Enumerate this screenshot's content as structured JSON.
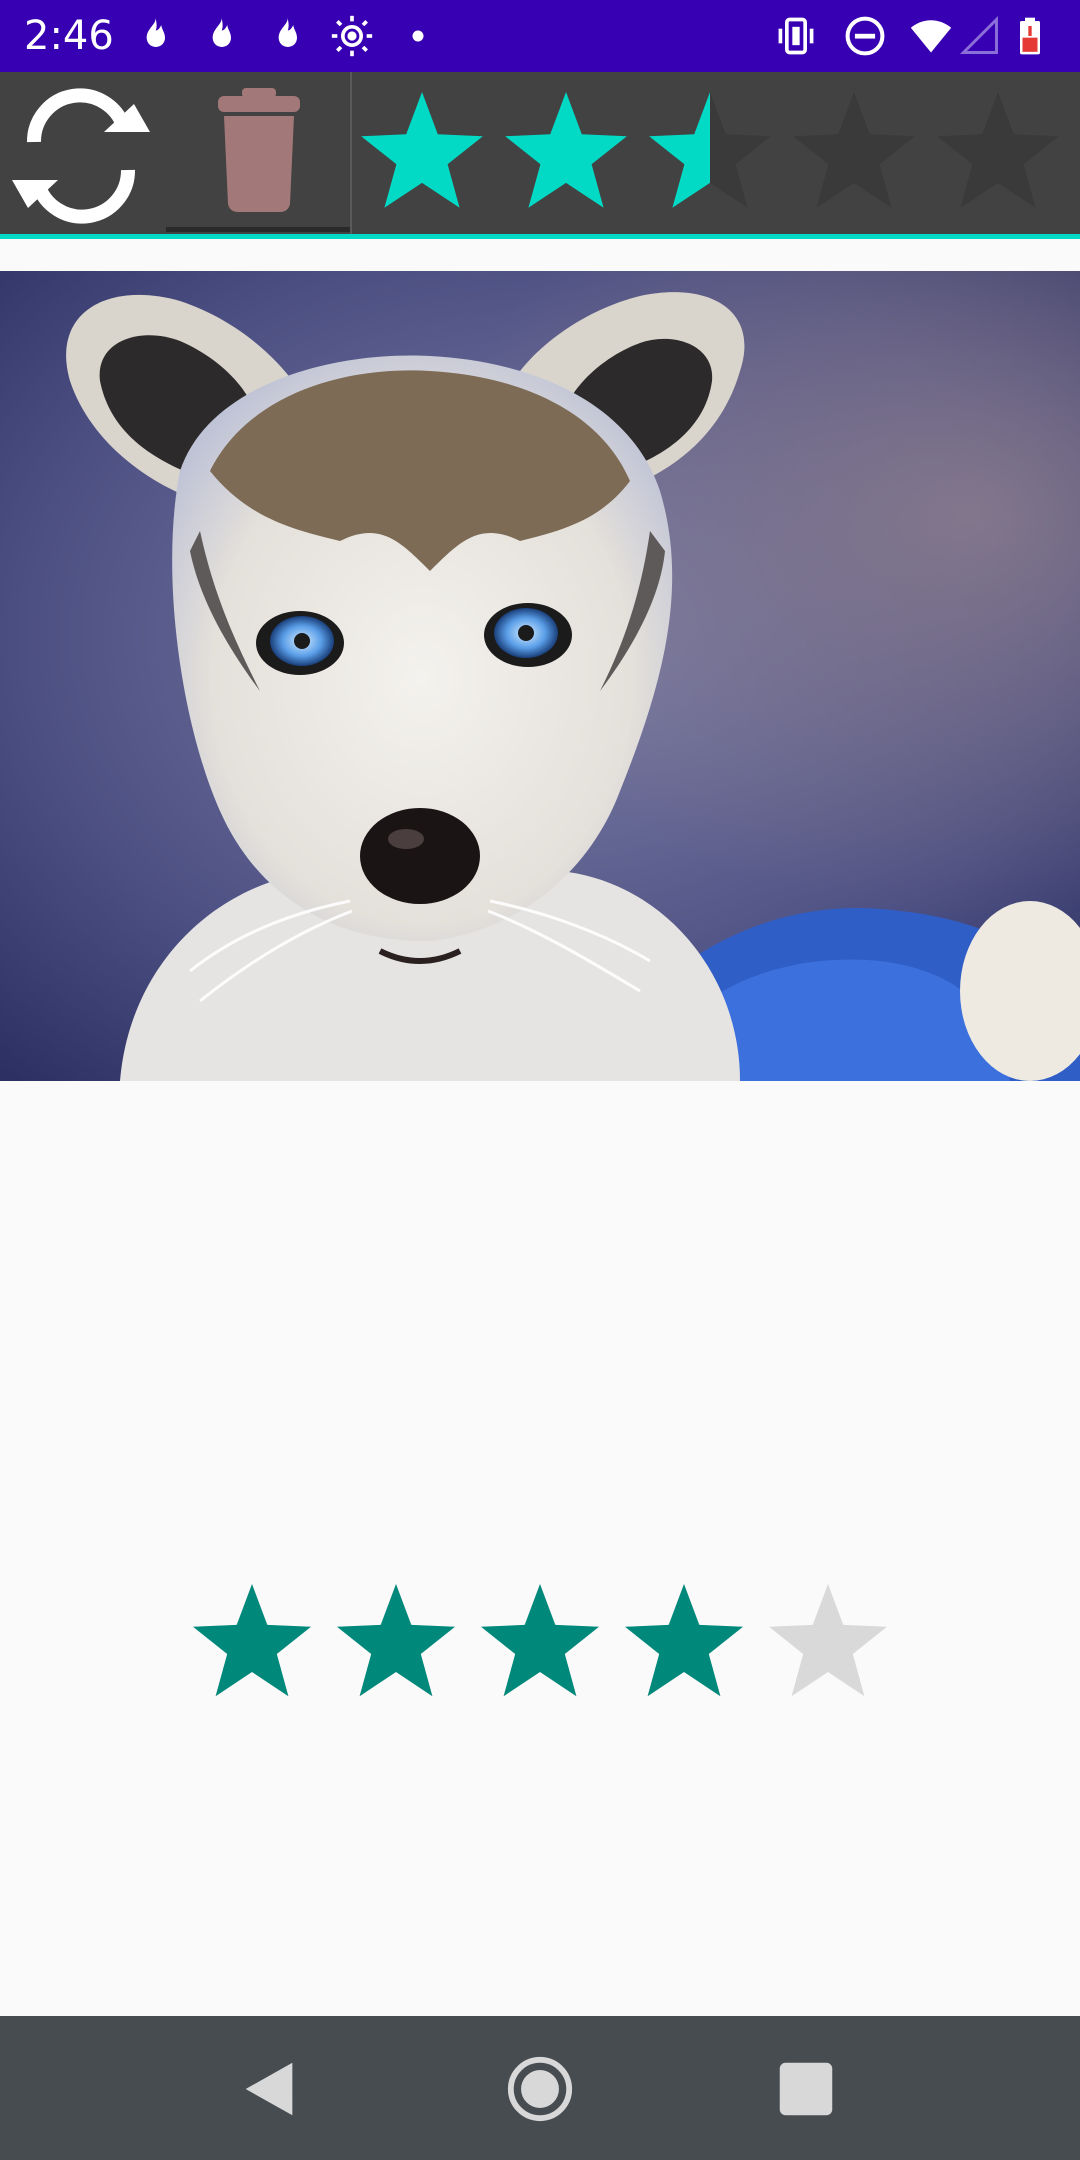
{
  "status_bar": {
    "time": "2:46",
    "background": "#3700b3",
    "left_icons": [
      "flame-icon",
      "flame-icon",
      "flame-icon",
      "brightness-icon",
      "dot-icon"
    ],
    "right_icons": [
      "vibrate-icon",
      "do-not-disturb-icon",
      "wifi-icon",
      "signal-icon",
      "battery-icon"
    ]
  },
  "toolbar": {
    "background": "#424242",
    "accent": "#03dac5",
    "refresh_icon": "refresh-icon",
    "delete_icon": "trash-icon",
    "rating": {
      "max": 5,
      "value": 2.5,
      "fill_color": "#03dac5",
      "empty_color": "#3a3a3a"
    }
  },
  "photo": {
    "subject": "husky-puppy"
  },
  "rating": {
    "max": 5,
    "value": 4,
    "fill_color": "#00897b",
    "empty_color": "#d9d9d9"
  },
  "nav_bar": {
    "background": "#474c51",
    "buttons": [
      "back-icon",
      "home-icon",
      "recents-icon"
    ]
  }
}
